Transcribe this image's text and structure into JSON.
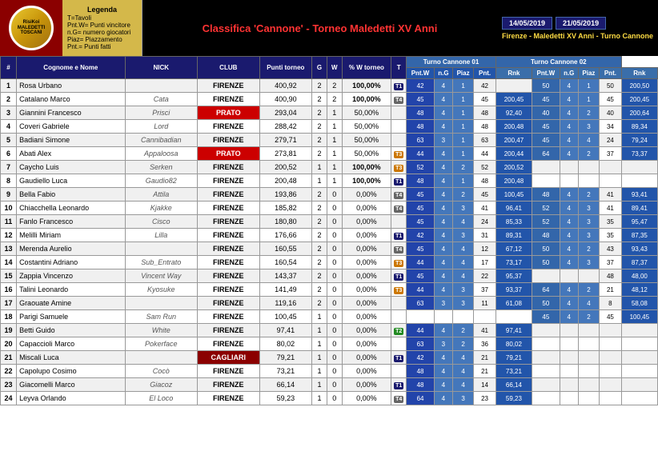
{
  "header": {
    "legend_title": "Legenda",
    "legend_items": [
      "T=Tavoli",
      "Pnt.W= Punti vincitore",
      "n.G= numero giocatori",
      "Piaz= Piazzamento",
      "Pnt.= Punti fatti"
    ],
    "title": "Classifica 'Cannone' - Torneo Maledetti XV Anni",
    "date1": "14/05/2019",
    "date2": "21/05/2019",
    "location": "Firenze - Maledetti XV Anni - Turno Cannone",
    "turno1": "Turno Cannone 01",
    "turno2": "Turno Cannone 02"
  },
  "columns": {
    "pos": "#",
    "name": "Cognome e Nome",
    "nick": "NICK",
    "club": "CLUB",
    "punti": "Punti torneo",
    "g": "G",
    "w": "W",
    "pct": "% W torneo",
    "t": "T",
    "pntw": "Pnt.W",
    "ng": "n.G",
    "piaz": "Piaz",
    "pnt": "Pnt.",
    "rnk": "Rnk"
  },
  "rows": [
    {
      "pos": 1,
      "name": "Rosa Urbano",
      "nick": "",
      "club": "FIRENZE",
      "pts": "400,92",
      "g": 2,
      "w": 2,
      "pct": "100,00%",
      "t": "T1",
      "c1_pntw": 42,
      "c1_ng": 4,
      "c1_piaz": 1,
      "c1_pnt": 42,
      "c1_rnk": "",
      "c2_pntw": 50,
      "c2_ng": 4,
      "c2_piaz": 1,
      "c2_pnt": 50,
      "c2_rnk": "200,50",
      "club_class": ""
    },
    {
      "pos": 2,
      "name": "Catalano Marco",
      "nick": "Cata",
      "club": "FIRENZE",
      "pts": "400,90",
      "g": 2,
      "w": 2,
      "pct": "100,00%",
      "t": "T4",
      "c1_pntw": 45,
      "c1_ng": 4,
      "c1_piaz": 1,
      "c1_pnt": 45,
      "c1_rnk": "200,45",
      "c2_pntw": 45,
      "c2_ng": 4,
      "c2_piaz": 1,
      "c2_pnt": 45,
      "c2_rnk": "200,45",
      "club_class": ""
    },
    {
      "pos": 3,
      "name": "Giannini Francesco",
      "nick": "Prisci",
      "club": "PRATO",
      "pts": "293,04",
      "g": 2,
      "w": 1,
      "pct": "50,00%",
      "t": "",
      "c1_pntw": 48,
      "c1_ng": 4,
      "c1_piaz": 1,
      "c1_pnt": 48,
      "c1_rnk": "92,40",
      "c2_pntw": 40,
      "c2_ng": 4,
      "c2_piaz": 2,
      "c2_pnt": 40,
      "c2_rnk": "200,64",
      "club_class": "prato"
    },
    {
      "pos": 4,
      "name": "Coveri Gabriele",
      "nick": "Lord",
      "club": "FIRENZE",
      "pts": "288,42",
      "g": 2,
      "w": 1,
      "pct": "50,00%",
      "t": "",
      "c1_pntw": 48,
      "c1_ng": 4,
      "c1_piaz": 1,
      "c1_pnt": 48,
      "c1_rnk": "200,48",
      "c2_pntw": 45,
      "c2_ng": 4,
      "c2_piaz": 3,
      "c2_pnt": 34,
      "c2_rnk": "89,34",
      "club_class": ""
    },
    {
      "pos": 5,
      "name": "Badiani Simone",
      "nick": "Cannibadian",
      "club": "FIRENZE",
      "pts": "279,71",
      "g": 2,
      "w": 1,
      "pct": "50,00%",
      "t": "",
      "c1_pntw": 63,
      "c1_ng": 3,
      "c1_piaz": 1,
      "c1_pnt": 63,
      "c1_rnk": "200,47",
      "c2_pntw": 45,
      "c2_ng": 4,
      "c2_piaz": 4,
      "c2_pnt": 24,
      "c2_rnk": "79,24",
      "club_class": ""
    },
    {
      "pos": 6,
      "name": "Abati Alex",
      "nick": "Appaloosa",
      "club": "PRATO",
      "pts": "273,81",
      "g": 2,
      "w": 1,
      "pct": "50,00%",
      "t": "T3",
      "c1_pntw": 44,
      "c1_ng": 4,
      "c1_piaz": 1,
      "c1_pnt": 44,
      "c1_rnk": "200,44",
      "c2_pntw": 64,
      "c2_ng": 4,
      "c2_piaz": 2,
      "c2_pnt": 37,
      "c2_rnk": "73,37",
      "club_class": "prato"
    },
    {
      "pos": 7,
      "name": "Caycho Luis",
      "nick": "Serken",
      "club": "FIRENZE",
      "pts": "200,52",
      "g": 1,
      "w": 1,
      "pct": "100,00%",
      "t": "T3",
      "c1_pntw": 52,
      "c1_ng": 4,
      "c1_piaz": 2,
      "c1_pnt": 52,
      "c1_rnk": "200,52",
      "c2_pntw": "",
      "c2_ng": "",
      "c2_piaz": "",
      "c2_pnt": "",
      "c2_rnk": "",
      "club_class": ""
    },
    {
      "pos": 8,
      "name": "Gaudiello Luca",
      "nick": "Gaudio82",
      "club": "FIRENZE",
      "pts": "200,48",
      "g": 1,
      "w": 1,
      "pct": "100,00%",
      "t": "T1",
      "c1_pntw": 48,
      "c1_ng": 4,
      "c1_piaz": 1,
      "c1_pnt": 48,
      "c1_rnk": "200,48",
      "c2_pntw": "",
      "c2_ng": "",
      "c2_piaz": "",
      "c2_pnt": "",
      "c2_rnk": "",
      "club_class": ""
    },
    {
      "pos": 9,
      "name": "Bella Fabio",
      "nick": "Attila",
      "club": "FIRENZE",
      "pts": "193,86",
      "g": 2,
      "w": 0,
      "pct": "0,00%",
      "t": "T4",
      "c1_pntw": 45,
      "c1_ng": 4,
      "c1_piaz": 2,
      "c1_pnt": 45,
      "c1_rnk": "100,45",
      "c2_pntw": 48,
      "c2_ng": 4,
      "c2_piaz": 2,
      "c2_pnt": 41,
      "c2_rnk": "93,41",
      "club_class": ""
    },
    {
      "pos": 10,
      "name": "Chiacchella Leonardo",
      "nick": "Kjakke",
      "club": "FIRENZE",
      "pts": "185,82",
      "g": 2,
      "w": 0,
      "pct": "0,00%",
      "t": "T4",
      "c1_pntw": 45,
      "c1_ng": 4,
      "c1_piaz": 3,
      "c1_pnt": 41,
      "c1_rnk": "96,41",
      "c2_pntw": 52,
      "c2_ng": 4,
      "c2_piaz": 3,
      "c2_pnt": 41,
      "c2_rnk": "89,41",
      "club_class": ""
    },
    {
      "pos": 11,
      "name": "Fanlo Francesco",
      "nick": "Cisco",
      "club": "FIRENZE",
      "pts": "180,80",
      "g": 2,
      "w": 0,
      "pct": "0,00%",
      "t": "",
      "c1_pntw": 45,
      "c1_ng": 4,
      "c1_piaz": 4,
      "c1_pnt": 24,
      "c1_rnk": "85,33",
      "c2_pntw": 52,
      "c2_ng": 4,
      "c2_piaz": 3,
      "c2_pnt": 35,
      "c2_rnk": "95,47",
      "club_class": ""
    },
    {
      "pos": 12,
      "name": "Melilli Miriam",
      "nick": "Lilla",
      "club": "FIRENZE",
      "pts": "176,66",
      "g": 2,
      "w": 0,
      "pct": "0,00%",
      "t": "T1",
      "c1_pntw": 42,
      "c1_ng": 4,
      "c1_piaz": 3,
      "c1_pnt": 31,
      "c1_rnk": "89,31",
      "c2_pntw": 48,
      "c2_ng": 4,
      "c2_piaz": 3,
      "c2_pnt": 35,
      "c2_rnk": "87,35",
      "club_class": ""
    },
    {
      "pos": 13,
      "name": "Merenda Aurelio",
      "nick": "",
      "club": "FIRENZE",
      "pts": "160,55",
      "g": 2,
      "w": 0,
      "pct": "0,00%",
      "t": "T4",
      "c1_pntw": 45,
      "c1_ng": 4,
      "c1_piaz": 4,
      "c1_pnt": 12,
      "c1_rnk": "67,12",
      "c2_pntw": 50,
      "c2_ng": 4,
      "c2_piaz": 2,
      "c2_pnt": 43,
      "c2_rnk": "93,43",
      "club_class": ""
    },
    {
      "pos": 14,
      "name": "Costantini Adriano",
      "nick": "Sub_Entrato",
      "club": "FIRENZE",
      "pts": "160,54",
      "g": 2,
      "w": 0,
      "pct": "0,00%",
      "t": "T3",
      "c1_pntw": 44,
      "c1_ng": 4,
      "c1_piaz": 4,
      "c1_pnt": 17,
      "c1_rnk": "73,17",
      "c2_pntw": 50,
      "c2_ng": 4,
      "c2_piaz": 3,
      "c2_pnt": 37,
      "c2_rnk": "87,37",
      "club_class": ""
    },
    {
      "pos": 15,
      "name": "Zappia Vincenzo",
      "nick": "Vincent Way",
      "club": "FIRENZE",
      "pts": "143,37",
      "g": 2,
      "w": 0,
      "pct": "0,00%",
      "t": "T1",
      "c1_pntw": 45,
      "c1_ng": 4,
      "c1_piaz": 4,
      "c1_pnt": 22,
      "c1_rnk": "95,37",
      "c2_pntw": "",
      "c2_ng": "",
      "c2_piaz": "",
      "c2_pnt": 48,
      "c2_rnk": "48,00",
      "club_class": ""
    },
    {
      "pos": 16,
      "name": "Talini Leonardo",
      "nick": "Kyosuke",
      "club": "FIRENZE",
      "pts": "141,49",
      "g": 2,
      "w": 0,
      "pct": "0,00%",
      "t": "T3",
      "c1_pntw": 44,
      "c1_ng": 4,
      "c1_piaz": 3,
      "c1_pnt": 37,
      "c1_rnk": "93,37",
      "c2_pntw": 64,
      "c2_ng": 4,
      "c2_piaz": 2,
      "c2_pnt": 21,
      "c2_rnk": "48,12",
      "club_class": ""
    },
    {
      "pos": 17,
      "name": "Graouate Amine",
      "nick": "",
      "club": "FIRENZE",
      "pts": "119,16",
      "g": 2,
      "w": 0,
      "pct": "0,00%",
      "t": "",
      "c1_pntw": 63,
      "c1_ng": 3,
      "c1_piaz": 3,
      "c1_pnt": 11,
      "c1_rnk": "61,08",
      "c2_pntw": 50,
      "c2_ng": 4,
      "c2_piaz": 4,
      "c2_pnt": 8,
      "c2_rnk": "58,08",
      "club_class": ""
    },
    {
      "pos": 18,
      "name": "Parigi Samuele",
      "nick": "Sam Run",
      "club": "FIRENZE",
      "pts": "100,45",
      "g": 1,
      "w": 0,
      "pct": "0,00%",
      "t": "",
      "c1_pntw": "",
      "c1_ng": "",
      "c1_piaz": "",
      "c1_pnt": "",
      "c1_rnk": "",
      "c2_pntw": 45,
      "c2_ng": 4,
      "c2_piaz": 2,
      "c2_pnt": 45,
      "c2_rnk": "100,45",
      "club_class": ""
    },
    {
      "pos": 19,
      "name": "Betti Guido",
      "nick": "White",
      "club": "FIRENZE",
      "pts": "97,41",
      "g": 1,
      "w": 0,
      "pct": "0,00%",
      "t": "T2",
      "c1_pntw": 44,
      "c1_ng": 4,
      "c1_piaz": 2,
      "c1_pnt": 41,
      "c1_rnk": "97,41",
      "c2_pntw": "",
      "c2_ng": "",
      "c2_piaz": "",
      "c2_pnt": "",
      "c2_rnk": "",
      "club_class": ""
    },
    {
      "pos": 20,
      "name": "Capaccioli Marco",
      "nick": "Pokerface",
      "club": "FIRENZE",
      "pts": "80,02",
      "g": 1,
      "w": 0,
      "pct": "0,00%",
      "t": "",
      "c1_pntw": 63,
      "c1_ng": 3,
      "c1_piaz": 2,
      "c1_pnt": 36,
      "c1_rnk": "80,02",
      "c2_pntw": "",
      "c2_ng": "",
      "c2_piaz": "",
      "c2_pnt": "",
      "c2_rnk": "",
      "club_class": ""
    },
    {
      "pos": 21,
      "name": "Miscali Luca",
      "nick": "",
      "club": "CAGLIARI",
      "pts": "79,21",
      "g": 1,
      "w": 0,
      "pct": "0,00%",
      "t": "T1",
      "c1_pntw": 42,
      "c1_ng": 4,
      "c1_piaz": 4,
      "c1_pnt": 21,
      "c1_rnk": "79,21",
      "c2_pntw": "",
      "c2_ng": "",
      "c2_piaz": "",
      "c2_pnt": "",
      "c2_rnk": "",
      "club_class": "cagliari"
    },
    {
      "pos": 22,
      "name": "Capolupo Cosimo",
      "nick": "Cocò",
      "club": "FIRENZE",
      "pts": "73,21",
      "g": 1,
      "w": 0,
      "pct": "0,00%",
      "t": "",
      "c1_pntw": 48,
      "c1_ng": 4,
      "c1_piaz": 4,
      "c1_pnt": 21,
      "c1_rnk": "73,21",
      "c2_pntw": "",
      "c2_ng": "",
      "c2_piaz": "",
      "c2_pnt": "",
      "c2_rnk": "",
      "club_class": ""
    },
    {
      "pos": 23,
      "name": "Giacomelli Marco",
      "nick": "Giacoz",
      "club": "FIRENZE",
      "pts": "66,14",
      "g": 1,
      "w": 0,
      "pct": "0,00%",
      "t": "T1",
      "c1_pntw": 48,
      "c1_ng": 4,
      "c1_piaz": 4,
      "c1_pnt": 14,
      "c1_rnk": "66,14",
      "c2_pntw": "",
      "c2_ng": "",
      "c2_piaz": "",
      "c2_pnt": "",
      "c2_rnk": "",
      "club_class": ""
    },
    {
      "pos": 24,
      "name": "Leyva Orlando",
      "nick": "El Loco",
      "club": "FIRENZE",
      "pts": "59,23",
      "g": 1,
      "w": 0,
      "pct": "0,00%",
      "t": "T4",
      "c1_pntw": 64,
      "c1_ng": 4,
      "c1_piaz": 3,
      "c1_pnt": 23,
      "c1_rnk": "59,23",
      "c2_pntw": "",
      "c2_ng": "",
      "c2_piaz": "",
      "c2_pnt": "",
      "c2_rnk": "",
      "club_class": ""
    }
  ]
}
